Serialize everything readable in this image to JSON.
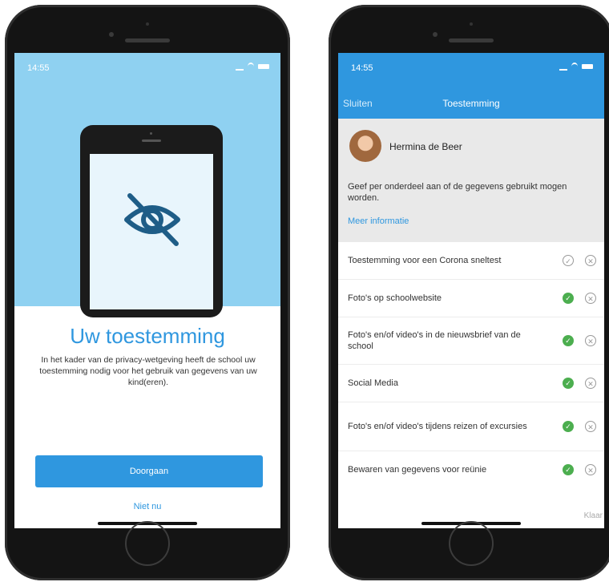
{
  "left": {
    "time": "14:55",
    "title": "Uw toestemming",
    "description": "In het kader van de privacy-wetgeving heeft de school uw toestemming nodig voor het gebruik van gegevens van uw kind(eren).",
    "continue": "Doorgaan",
    "not_now": "Niet nu",
    "illustration_icon": "eye-off-icon",
    "accent": "#2f97df"
  },
  "right": {
    "time": "14:55",
    "nav": {
      "close": "Sluiten",
      "title": "Toestemming"
    },
    "user": "Hermina de Beer",
    "info": "Geef per onderdeel aan of de gegevens gebruikt mogen worden.",
    "more": "Meer informatie",
    "items": [
      {
        "label": "Toestemming voor een Corona sneltest",
        "status": "unset"
      },
      {
        "label": "Foto's op schoolwebsite",
        "status": "allowed"
      },
      {
        "label": "Foto's en/of video's in de nieuwsbrief van de school",
        "status": "allowed"
      },
      {
        "label": "Social Media",
        "status": "allowed"
      },
      {
        "label": "Foto's en/of video's tijdens reizen of excursies",
        "status": "allowed"
      },
      {
        "label": "Bewaren van gegevens voor reünie",
        "status": "allowed"
      }
    ],
    "done": "Klaar",
    "accent": "#2f97df",
    "allowed_color": "#4cae4f"
  }
}
